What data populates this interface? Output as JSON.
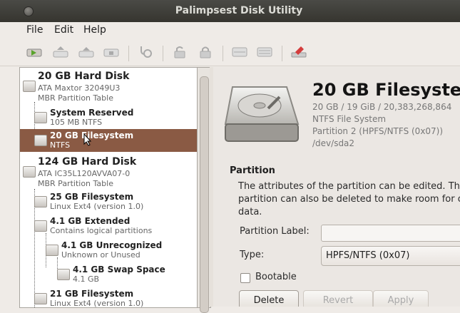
{
  "window": {
    "title": "Palimpsest Disk Utility"
  },
  "menu": {
    "file": "File",
    "edit": "Edit",
    "help": "Help"
  },
  "toolbar": {
    "icons": [
      "drive-play-icon",
      "drive-eject-icon",
      "drive-eject-alt-icon",
      "drive-stop-icon",
      "stethoscope-icon",
      "unlock-icon",
      "lock-icon",
      "format-drive-icon",
      "partition-icon",
      "erase-icon"
    ]
  },
  "tree": [
    {
      "name": "20 GB Hard Disk",
      "sub1": "ATA Maxtor 32049U3",
      "sub2": "MBR Partition Table"
    },
    {
      "name": "System Reserved",
      "sub1": "105 MB NTFS"
    },
    {
      "name": "20 GB Filesystem",
      "sub1": "NTFS"
    },
    {
      "name": "124 GB Hard Disk",
      "sub1": "ATA IC35L120AVVA07-0",
      "sub2": "MBR Partition Table"
    },
    {
      "name": "25 GB Filesystem",
      "sub1": "Linux Ext4 (version 1.0)"
    },
    {
      "name": "4.1 GB Extended",
      "sub1": "Contains logical partitions"
    },
    {
      "name": "4.1 GB Unrecognized",
      "sub1": "Unknown or Unused"
    },
    {
      "name": "4.1 GB Swap Space",
      "sub1": "4.1 GB"
    },
    {
      "name": "21 GB Filesystem",
      "sub1": "Linux Ext4 (version 1.0)"
    }
  ],
  "detail": {
    "title": "20 GB Filesyste",
    "size": "20 GB / 19 GiB / 20,383,268,864",
    "fs": "NTFS File System",
    "partition": "Partition 2 (HPFS/NTFS (0x07))",
    "device": "/dev/sda2"
  },
  "partition": {
    "heading": "Partition",
    "desc1": "The attributes of the partition can be edited. The",
    "desc2": "partition can also be deleted to make room for o",
    "desc3": "data.",
    "label_text": "Partition Label:",
    "label_value": "",
    "type_text": "Type:",
    "type_value": "HPFS/NTFS (0x07)",
    "bootable_text": "Bootable",
    "delete": "Delete",
    "revert": "Revert",
    "apply": "Apply"
  }
}
